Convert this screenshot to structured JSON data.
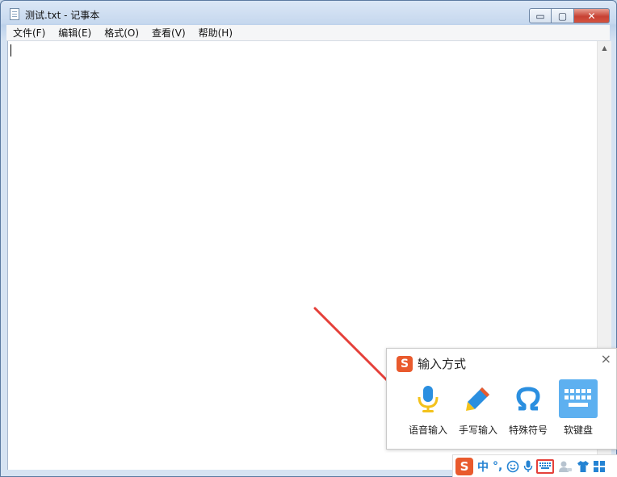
{
  "window": {
    "title": "测试.txt - 记事本",
    "controls": {
      "minimize": "▭",
      "maximize": "▢",
      "close": "✕"
    }
  },
  "menu": {
    "items": [
      {
        "label": "文件(F)"
      },
      {
        "label": "编辑(E)"
      },
      {
        "label": "格式(O)"
      },
      {
        "label": "查看(V)"
      },
      {
        "label": "帮助(H)"
      }
    ]
  },
  "editor": {
    "content": ""
  },
  "ime_panel": {
    "logo": "S",
    "title": "输入方式",
    "close": "×",
    "tools": [
      {
        "label": "语音输入",
        "icon": "microphone-icon"
      },
      {
        "label": "手写输入",
        "icon": "pencil-icon"
      },
      {
        "label": "特殊符号",
        "icon": "omega-icon"
      },
      {
        "label": "软键盘",
        "icon": "keyboard-icon",
        "active": true
      }
    ]
  },
  "ime_statusbar": {
    "logo": "S",
    "mode": "中",
    "punctuation": "°,",
    "icons": [
      "smiley-icon",
      "microphone-icon",
      "keyboard-icon",
      "user-icon",
      "shirt-icon",
      "grid-icon"
    ]
  },
  "colors": {
    "accent": "#e95a2d",
    "ime_blue": "#2483d3",
    "soft_keyboard_bg": "#5db0f0",
    "arrow": "#e5403a",
    "close_button": "#c74234"
  }
}
